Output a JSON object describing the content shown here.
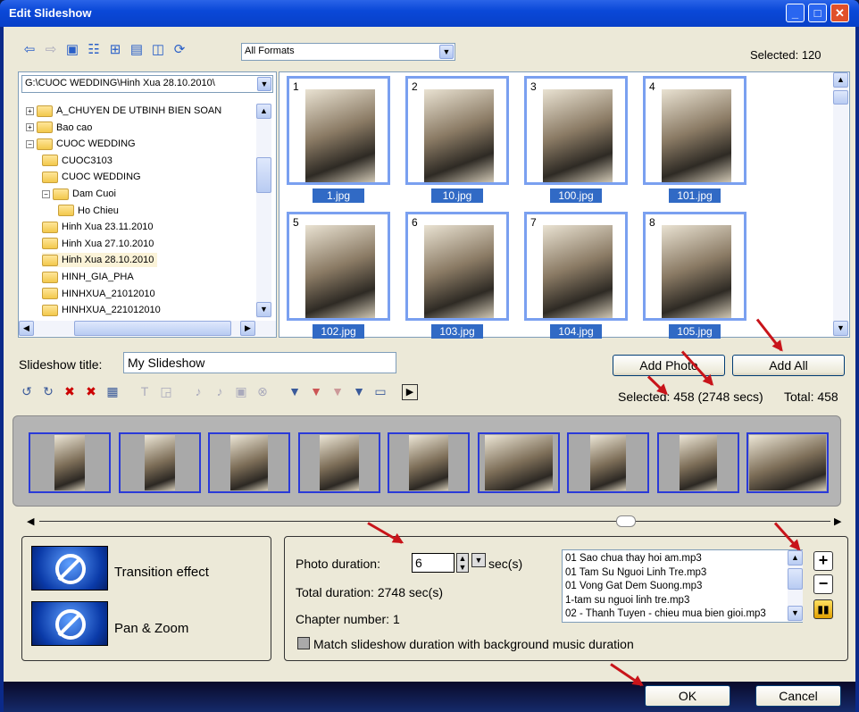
{
  "window": {
    "title": "Edit Slideshow",
    "min_label": "_",
    "max_label": "□",
    "close_label": "✕"
  },
  "toolbar": {
    "format_value": "All Formats",
    "selected_text": "Selected: 120"
  },
  "folder": {
    "path": "G:\\CUOC WEDDING\\Hinh Xua 28.10.2010\\"
  },
  "tree": [
    {
      "label": "A_CHUYEN DE UTBINH BIEN SOAN",
      "exp": "+"
    },
    {
      "label": "Bao cao",
      "exp": "+"
    },
    {
      "label": "CUOC WEDDING",
      "exp": "−"
    },
    {
      "label": "CUOC3103",
      "exp": ""
    },
    {
      "label": "CUOC WEDDING",
      "exp": ""
    },
    {
      "label": "Dam Cuoi",
      "exp": "−"
    },
    {
      "label": "Ho Chieu",
      "exp": ""
    },
    {
      "label": "Hinh Xua 23.11.2010",
      "exp": ""
    },
    {
      "label": "Hinh Xua 27.10.2010",
      "exp": ""
    },
    {
      "label": "Hinh Xua 28.10.2010",
      "exp": ""
    },
    {
      "label": "HINH_GIA_PHA",
      "exp": ""
    },
    {
      "label": "HINHXUA_21012010",
      "exp": ""
    },
    {
      "label": "HINHXUA_221012010",
      "exp": ""
    }
  ],
  "thumbnails": [
    {
      "num": "1",
      "name": "1.jpg"
    },
    {
      "num": "2",
      "name": "10.jpg"
    },
    {
      "num": "3",
      "name": "100.jpg"
    },
    {
      "num": "4",
      "name": "101.jpg"
    },
    {
      "num": "5",
      "name": "102.jpg"
    },
    {
      "num": "6",
      "name": "103.jpg"
    },
    {
      "num": "7",
      "name": "104.jpg"
    },
    {
      "num": "8",
      "name": "105.jpg"
    }
  ],
  "slideshow": {
    "title_label": "Slideshow title:",
    "title_value": "My Slideshow",
    "add_photo": "Add Photo",
    "add_all": "Add All",
    "selected_text": "Selected: 458 (2748 secs)",
    "total_text": "Total: 458"
  },
  "effects": {
    "transition": "Transition effect",
    "panzoom": "Pan & Zoom"
  },
  "duration": {
    "label": "Photo duration:",
    "value": "6",
    "unit": "sec(s)",
    "total": "Total duration: 2748 sec(s)",
    "chapter": "Chapter number: 1",
    "match_label": "Match slideshow duration with background music duration"
  },
  "music": [
    "01 Sao chua thay hoi am.mp3",
    "01 Tam Su Nguoi Linh Tre.mp3",
    "01 Vong Gat Dem Suong.mp3",
    "1-tam su nguoi linh tre.mp3",
    "02 - Thanh Tuyen - chieu mua bien gioi.mp3"
  ],
  "buttons": {
    "ok": "OK",
    "cancel": "Cancel"
  },
  "colors": {
    "selection": "#316ac5",
    "annotation_arrow": "#c8141a"
  }
}
